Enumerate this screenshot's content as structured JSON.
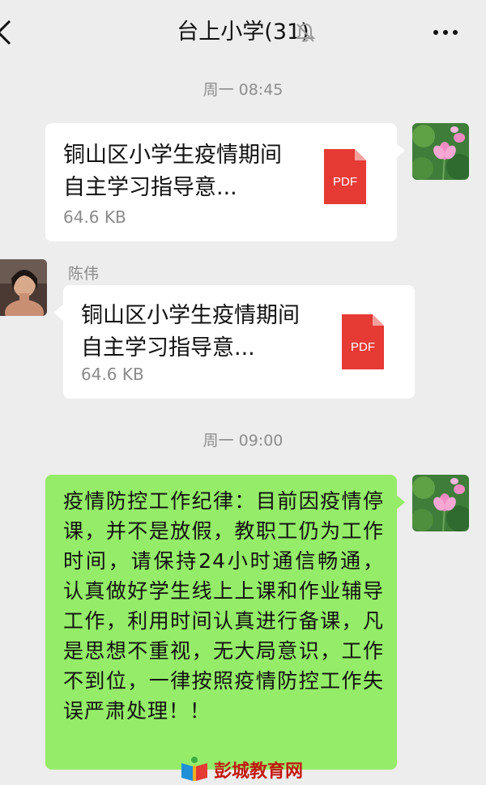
{
  "header": {
    "title": "台上小学(31)",
    "back_icon": "back-arrow-icon",
    "mute_icon": "bell-muted-icon",
    "more_icon": "more-dots-icon"
  },
  "messages": [
    {
      "type": "timestamp",
      "text": "周一 08:45"
    },
    {
      "type": "file",
      "side": "right",
      "title_line1": "铜山区小学生疫情期间",
      "title_line2": "自主学习指导意...",
      "size": "64.6 KB",
      "file_type": "PDF",
      "avatar": "lotus-flower-avatar"
    },
    {
      "type": "file",
      "side": "left",
      "sender": "陈伟",
      "title_line1": "铜山区小学生疫情期间",
      "title_line2": "自主学习指导意...",
      "size": "64.6 KB",
      "file_type": "PDF",
      "avatar": "person-photo-avatar"
    },
    {
      "type": "timestamp",
      "text": "周一 09:00"
    },
    {
      "type": "text",
      "side": "right",
      "text": "疫情防控工作纪律：目前因疫情停课，并不是放假，教职工仍为工作时间，请保持24小时通信畅通，认真做好学生线上上课和作业辅导工作，利用时间认真进行备课，凡是思想不重视，无大局意识，工作不到位，一律按照疫情防控工作失误严肃处理！！",
      "avatar": "lotus-flower-avatar"
    }
  ],
  "watermark": {
    "text": "彭城教育网"
  },
  "colors": {
    "background": "#ededed",
    "bubble_white": "#ffffff",
    "bubble_green": "#95ec69",
    "pdf_red": "#e63a35",
    "watermark_red": "#c21810"
  }
}
